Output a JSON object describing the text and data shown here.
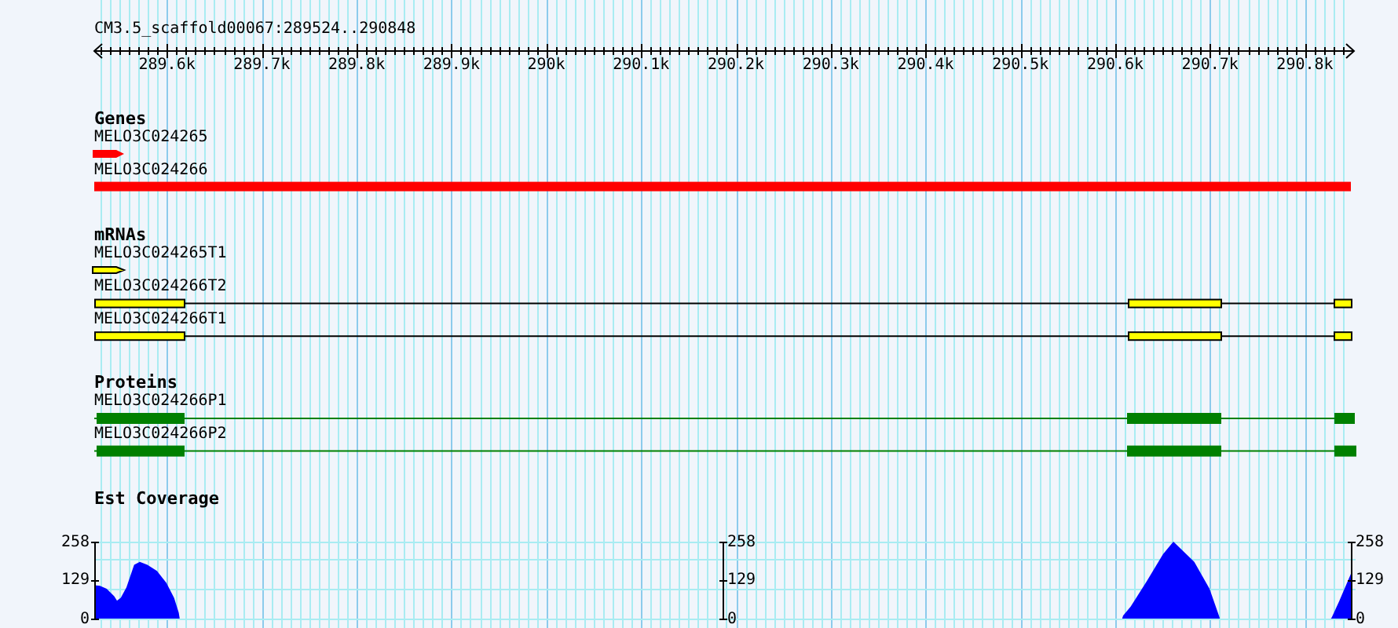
{
  "ruler": {
    "title": "CM3.5_scaffold00067:289524..290848",
    "ticks": [
      "289.6k",
      "289.7k",
      "289.8k",
      "289.9k",
      "290k",
      "290.1k",
      "290.2k",
      "290.3k",
      "290.4k",
      "290.5k",
      "290.6k",
      "290.7k",
      "290.8k"
    ]
  },
  "tracks": [
    {
      "title": "Genes",
      "kind": "gene",
      "features": [
        {
          "name": "MELO3C024265"
        },
        {
          "name": "MELO3C024266"
        }
      ]
    },
    {
      "title": "mRNAs",
      "kind": "mrna",
      "features": [
        {
          "name": "MELO3C024265T1"
        },
        {
          "name": "MELO3C024266T2"
        },
        {
          "name": "MELO3C024266T1"
        }
      ]
    },
    {
      "title": "Proteins",
      "kind": "protein",
      "features": [
        {
          "name": "MELO3C024266P1"
        },
        {
          "name": "MELO3C024266P2"
        }
      ]
    }
  ],
  "coverage": {
    "title": "Est Coverage",
    "axes": [
      {
        "labels": [
          "258",
          "129",
          "0"
        ]
      },
      {
        "labels": [
          "258",
          "129",
          "0"
        ]
      },
      {
        "labels": [
          "258",
          "129",
          "0"
        ]
      }
    ]
  }
}
